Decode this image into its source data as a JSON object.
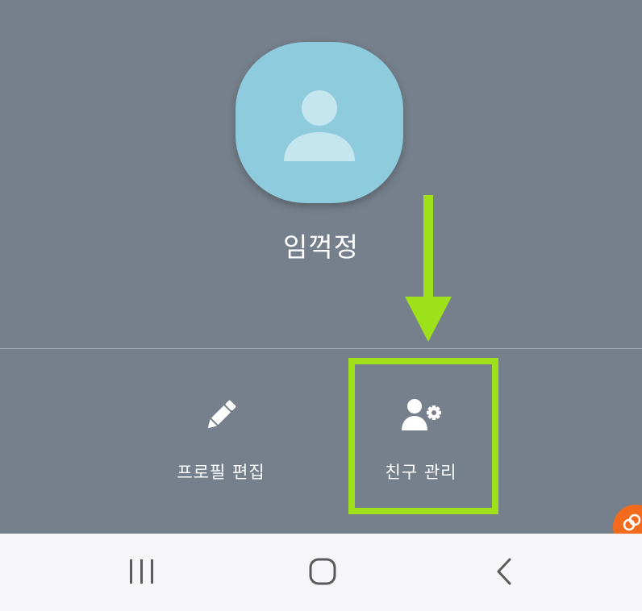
{
  "profile": {
    "name": "임꺽정",
    "avatar_icon": "person-icon",
    "avatar_color": "#8ecbdd"
  },
  "actions": {
    "edit_profile": {
      "label": "프로필 편집",
      "icon": "pencil-icon"
    },
    "manage_friends": {
      "label": "친구 관리",
      "icon": "person-settings-icon"
    }
  },
  "annotation": {
    "arrow_icon": "down-arrow-icon",
    "highlight_color": "#9ee01a"
  },
  "navbar": {
    "recents_icon": "recents-icon",
    "home_icon": "home-icon",
    "back_icon": "back-icon"
  },
  "colors": {
    "background": "#76808c",
    "navbar": "#f6f6f8",
    "badge": "#f26b1c"
  }
}
